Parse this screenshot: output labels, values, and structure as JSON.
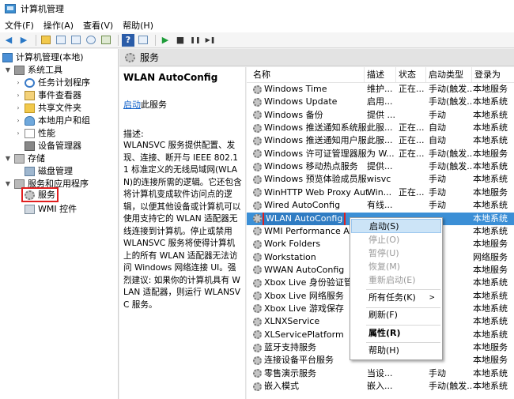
{
  "window": {
    "title": "计算机管理"
  },
  "menu": [
    "文件(F)",
    "操作(A)",
    "查看(V)",
    "帮助(H)"
  ],
  "toolbar": {
    "back": "◀",
    "forward": "▶",
    "help": "?",
    "play": "▶",
    "stop": "■",
    "pause": "❚❚",
    "restart": "▶❚"
  },
  "tree": {
    "root": "计算机管理(本地)",
    "system_tools": "系统工具",
    "task_scheduler": "任务计划程序",
    "event_viewer": "事件查看器",
    "shared_folders": "共享文件夹",
    "local_users": "本地用户和组",
    "performance": "性能",
    "device_manager": "设备管理器",
    "storage": "存储",
    "disk_mgmt": "磁盘管理",
    "services_apps": "服务和应用程序",
    "services": "服务",
    "wmi": "WMI 控件"
  },
  "pane_title": "服务",
  "detail": {
    "title": "WLAN AutoConfig",
    "start_link": "启动",
    "start_suffix": "此服务",
    "desc_label": "描述:",
    "desc_text": "WLANSVC 服务提供配置、发现、连接、断开与 IEEE 802.11 标准定义的无线局域网(WLAN)的连接所需的逻辑。它还包含将计算机变成软件访问点的逻辑，以便其他设备或计算机可以使用支持它的 WLAN 适配器无线连接到计算机。停止或禁用 WLANSVC 服务将使得计算机上的所有 WLAN 适配器无法访问 Windows 网络连接 UI。强烈建议: 如果你的计算机具有 WLAN 适配器，则运行 WLANSVC 服务。"
  },
  "columns": {
    "name": "名称",
    "desc": "描述",
    "status": "状态",
    "type": "启动类型",
    "logon": "登录为"
  },
  "rows": [
    {
      "name": "Windows Time",
      "desc": "维护...",
      "status": "正在...",
      "type": "手动(触发...",
      "logon": "本地服务"
    },
    {
      "name": "Windows Update",
      "desc": "启用...",
      "status": "",
      "type": "手动(触发...",
      "logon": "本地系统"
    },
    {
      "name": "Windows 备份",
      "desc": "提供 ...",
      "status": "",
      "type": "手动",
      "logon": "本地系统"
    },
    {
      "name": "Windows 推送通知系统服务",
      "desc": "此服...",
      "status": "正在...",
      "type": "自动",
      "logon": "本地系统"
    },
    {
      "name": "Windows 推送通知用户服...",
      "desc": "此服...",
      "status": "正在...",
      "type": "自动",
      "logon": "本地系统"
    },
    {
      "name": "Windows 许可证管理器服务",
      "desc": "为 W...",
      "status": "正在...",
      "type": "手动(触发...",
      "logon": "本地服务"
    },
    {
      "name": "Windows 移动热点服务",
      "desc": "提供...",
      "status": "",
      "type": "手动(触发...",
      "logon": "本地系统"
    },
    {
      "name": "Windows 预览体验成员服务",
      "desc": "wisvc",
      "status": "",
      "type": "手动",
      "logon": "本地系统"
    },
    {
      "name": "WinHTTP Web Proxy Aut...",
      "desc": "Win...",
      "status": "正在...",
      "type": "手动",
      "logon": "本地服务"
    },
    {
      "name": "Wired AutoConfig",
      "desc": "有线...",
      "status": "",
      "type": "手动",
      "logon": "本地系统"
    },
    {
      "name": "WLAN AutoConfig",
      "desc": "",
      "status": "",
      "type": "",
      "logon": "本地系统",
      "selected": true
    },
    {
      "name": "WMI Performance Ada...",
      "desc": "",
      "status": "",
      "type": "",
      "logon": "本地系统"
    },
    {
      "name": "Work Folders",
      "desc": "",
      "status": "",
      "type": "",
      "logon": "本地服务"
    },
    {
      "name": "Workstation",
      "desc": "",
      "status": "",
      "type": "",
      "logon": "网络服务"
    },
    {
      "name": "WWAN AutoConfig",
      "desc": "",
      "status": "",
      "type": "",
      "logon": "本地服务"
    },
    {
      "name": "Xbox Live 身份验证管理...",
      "desc": "",
      "status": "",
      "type": "",
      "logon": "本地系统"
    },
    {
      "name": "Xbox Live 网络服务",
      "desc": "",
      "status": "",
      "type": "",
      "logon": "本地系统"
    },
    {
      "name": "Xbox Live 游戏保存",
      "desc": "",
      "status": "",
      "type": "",
      "logon": "本地系统"
    },
    {
      "name": "XLNXService",
      "desc": "",
      "status": "",
      "type": "",
      "logon": "本地系统"
    },
    {
      "name": "XLServicePlatform",
      "desc": "",
      "status": "",
      "type": "",
      "logon": "本地系统"
    },
    {
      "name": "蓝牙支持服务",
      "desc": "",
      "status": "",
      "type": "",
      "logon": "本地服务"
    },
    {
      "name": "连接设备平台服务",
      "desc": "",
      "status": "",
      "type": "",
      "logon": "本地服务"
    },
    {
      "name": "零售演示服务",
      "desc": "当设...",
      "status": "",
      "type": "手动",
      "logon": "本地系统"
    },
    {
      "name": "嵌入模式",
      "desc": "嵌入...",
      "status": "",
      "type": "手动(触发...",
      "logon": "本地系统"
    }
  ],
  "context_menu": {
    "start": "启动(S)",
    "stop": "停止(O)",
    "pause": "暂停(U)",
    "resume": "恢复(M)",
    "restart": "重新启动(E)",
    "all_tasks": "所有任务(K)",
    "refresh": "刷新(F)",
    "properties": "属性(R)",
    "help": "帮助(H)"
  },
  "colors": {
    "selection": "#3b8fd6",
    "highlight_border": "#e01e1e",
    "menu_hover": "#cce4f7"
  }
}
